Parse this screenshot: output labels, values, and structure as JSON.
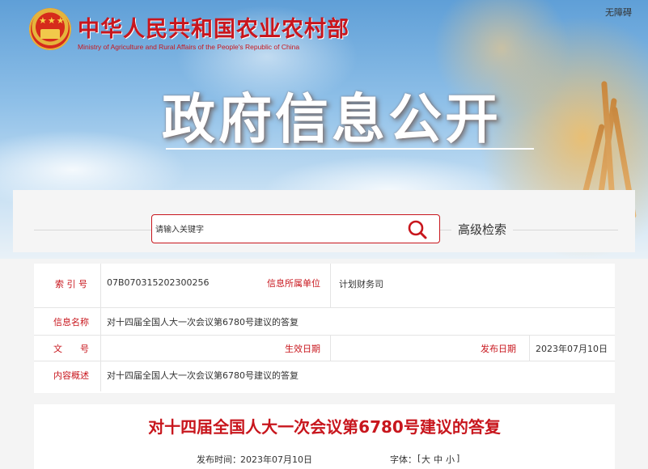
{
  "header": {
    "site_title": "中华人民共和国农业农村部",
    "site_subtitle": "Ministry of Agriculture and Rural Affairs of the People's Republic of China",
    "accessibility_link": "无障碍",
    "section_heading": "政府信息公开"
  },
  "search": {
    "placeholder": "请输入关键字",
    "advanced_label": "高级检索"
  },
  "info": {
    "index_label": "索 引 号",
    "index_value": "07B070315202300256",
    "dept_label": "信息所属单位",
    "dept_value": "计划财务司",
    "name_label": "信息名称",
    "name_value": "对十四届全国人大一次会议第6780号建议的答复",
    "doc_no_label": "文　　号",
    "doc_no_value": "",
    "effective_label": "生效日期",
    "effective_value": "",
    "publish_label": "发布日期",
    "publish_value": "2023年07月10日",
    "summary_label": "内容概述",
    "summary_value": "对十四届全国人大一次会议第6780号建议的答复"
  },
  "article": {
    "title": "对十四届全国人大一次会议第6780号建议的答复",
    "publish_time_label": "发布时间：",
    "publish_time_value": "2023年07月10日",
    "font_label": "字体：",
    "font_open": "[",
    "font_large": "大",
    "font_medium": "中",
    "font_small": "小",
    "font_close": "]"
  },
  "colors": {
    "accent": "#c8161d",
    "text": "#333333",
    "divider": "#e4e4e4"
  }
}
